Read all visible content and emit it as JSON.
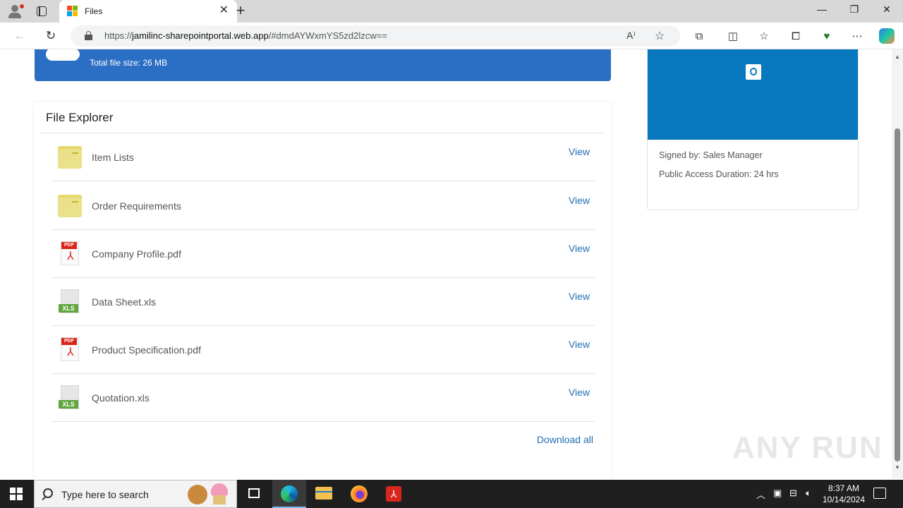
{
  "browser": {
    "tab_title": "Files",
    "url_prefix": "https://",
    "url_host": "jamilinc-sharepointportal.web.app",
    "url_rest": "/#dmdAYWxmYS5zd2lzcw=="
  },
  "banner": {
    "total_size": "Total file size: 26 MB"
  },
  "explorer": {
    "title": "File Explorer",
    "view_label": "View",
    "download_all": "Download all",
    "files": [
      {
        "name": "Item Lists",
        "icon": "folder-icon"
      },
      {
        "name": "Order Requirements",
        "icon": "folder-icon"
      },
      {
        "name": "Company Profile.pdf",
        "icon": "pdf-icon"
      },
      {
        "name": "Data Sheet.xls",
        "icon": "xls-icon"
      },
      {
        "name": "Product Specification.pdf",
        "icon": "pdf-icon"
      },
      {
        "name": "Quotation.xls",
        "icon": "xls-icon"
      }
    ],
    "pdf_badge": "PDF",
    "xls_badge": "XLS"
  },
  "side_card": {
    "signed_by": "Signed by: Sales Manager",
    "duration": "Public Access Duration: 24 hrs"
  },
  "watermark": "ANY RUN",
  "taskbar": {
    "search_placeholder": "Type here to search",
    "time": "8:37 AM",
    "date": "10/14/2024"
  },
  "colors": {
    "banner_blue": "#2b6fc4",
    "outlook_blue": "#0778bd",
    "link_blue": "#1f6fb5"
  }
}
